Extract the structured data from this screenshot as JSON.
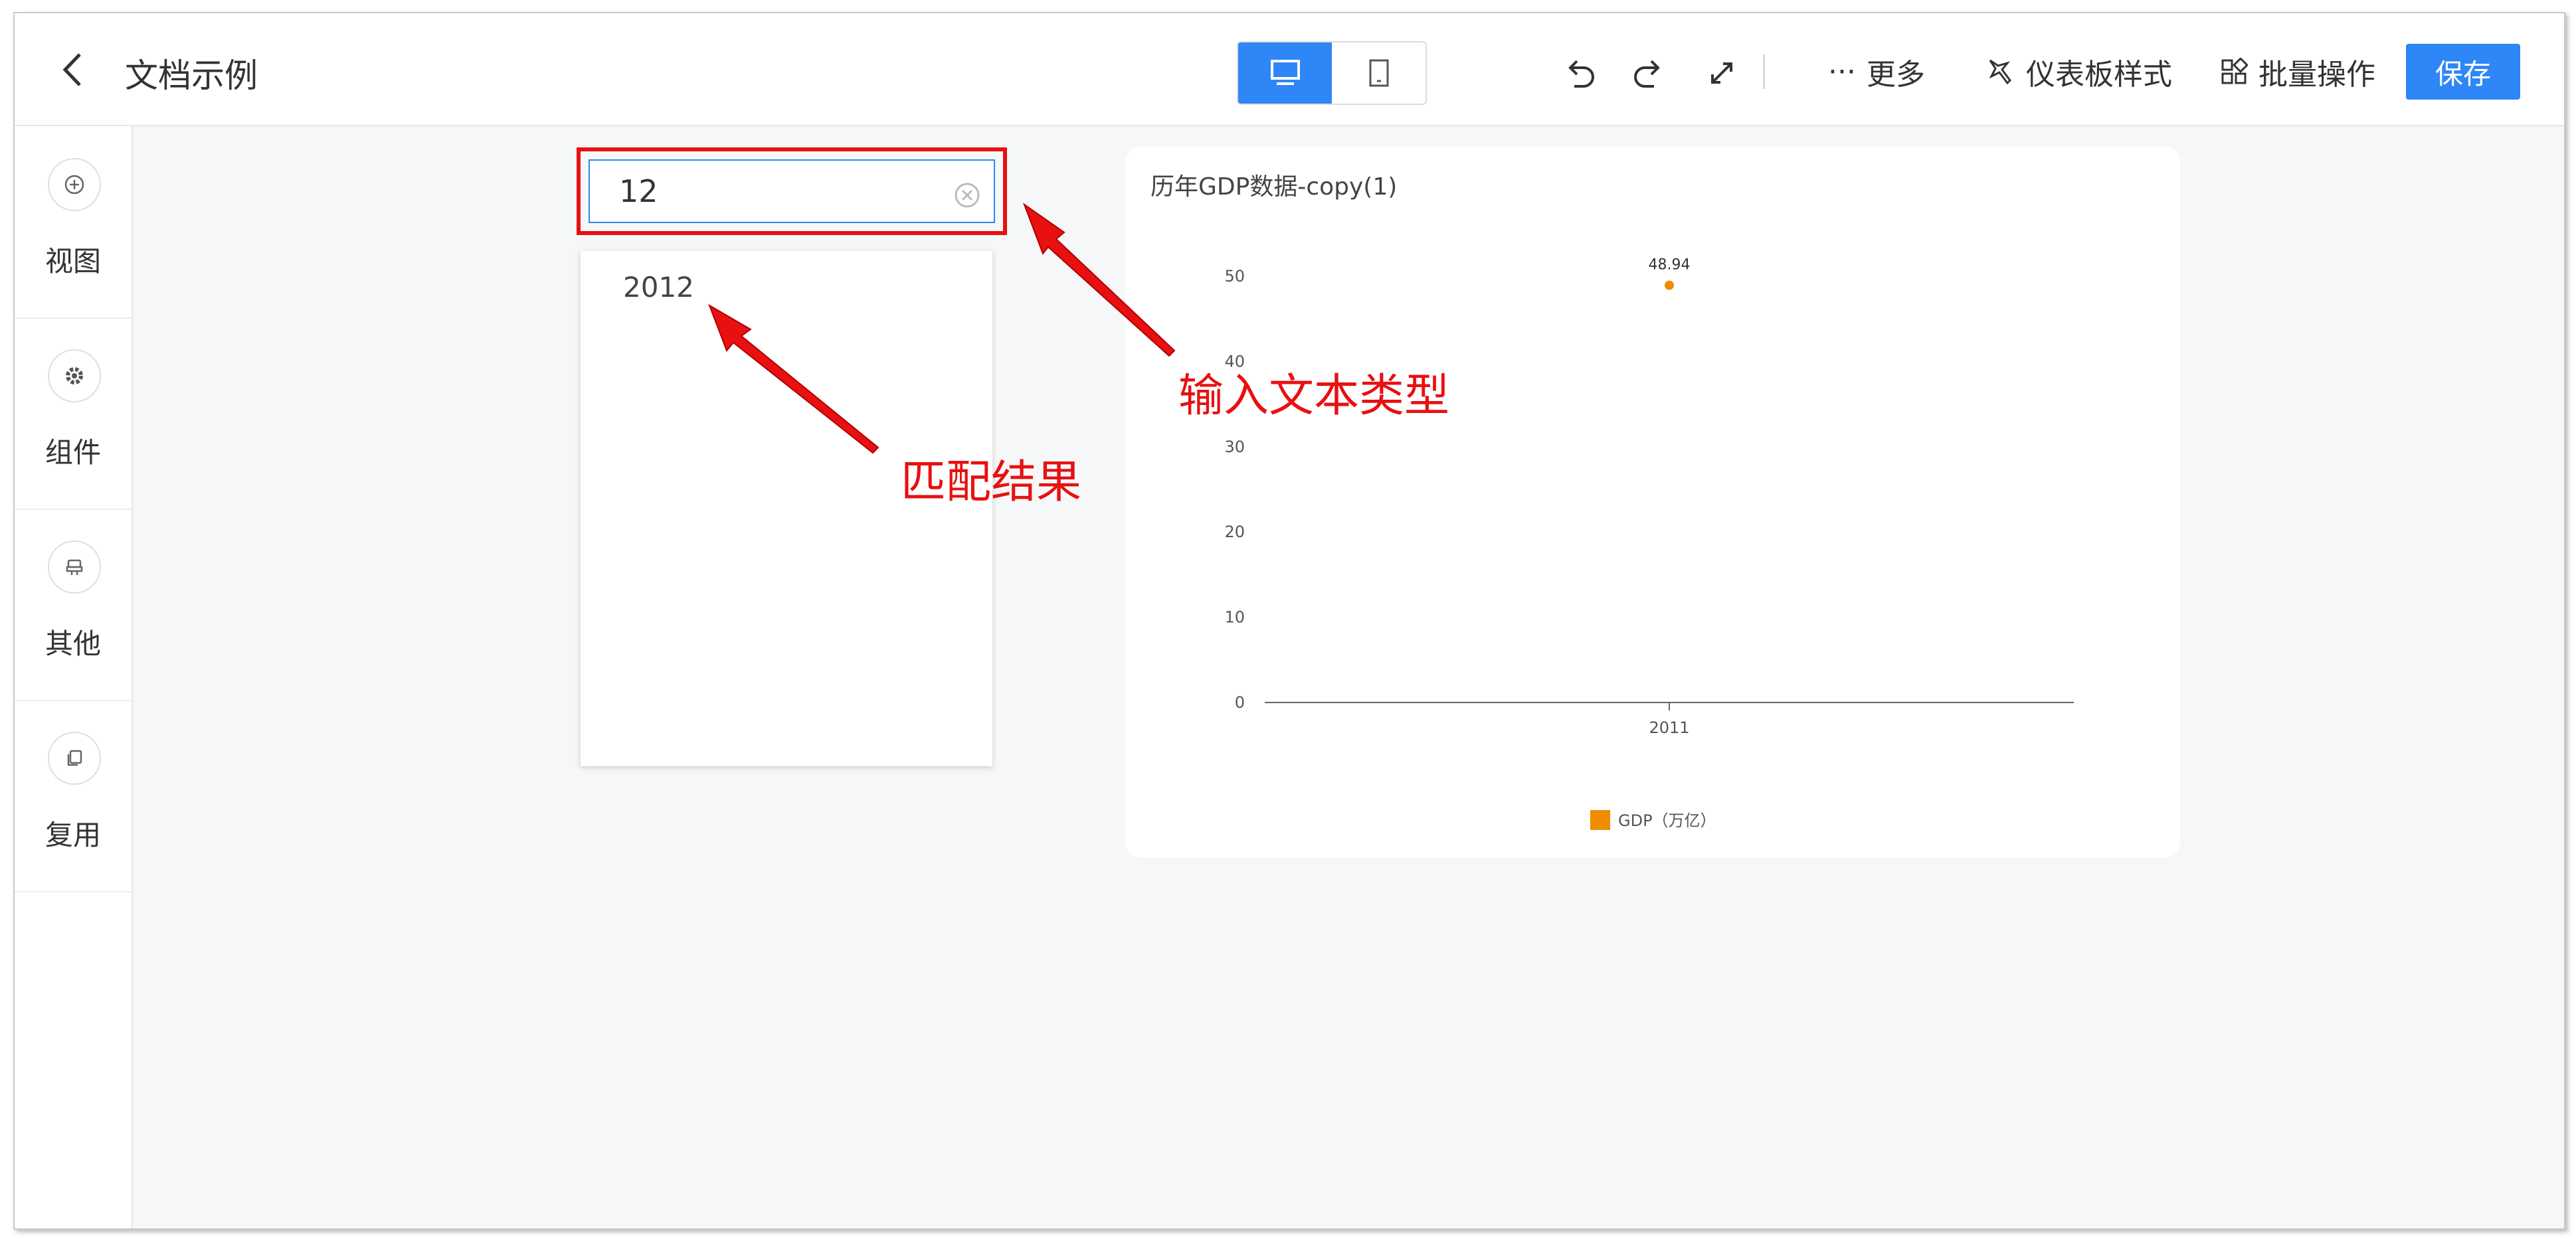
{
  "header": {
    "doc_title": "文档示例",
    "more_label": "更多",
    "dashboard_style_label": "仪表板样式",
    "batch_label": "批量操作",
    "save_label": "保存"
  },
  "sidebar": {
    "items": [
      {
        "label": "视图",
        "icon": "plus-circle-icon"
      },
      {
        "label": "组件",
        "icon": "gear-icon"
      },
      {
        "label": "其他",
        "icon": "stamp-icon"
      },
      {
        "label": "复用",
        "icon": "copy-icon"
      }
    ]
  },
  "search": {
    "value": "12",
    "results": [
      "2012"
    ]
  },
  "chart_data": {
    "type": "line",
    "title": "历年GDP数据-copy(1)",
    "categories": [
      "2011"
    ],
    "series": [
      {
        "name": "GDP（万亿）",
        "values": [
          48.94
        ],
        "color": "#f08c00"
      }
    ],
    "ylim": [
      0,
      50
    ],
    "yticks": [
      0,
      10,
      20,
      30,
      40,
      50
    ],
    "data_labels": [
      "48.94"
    ],
    "legend": "bottom-center"
  },
  "annotations": {
    "input_note": "输入文本类型",
    "match_note": "匹配结果"
  },
  "colors": {
    "accent": "#2f86f6",
    "annotation": "#e81010",
    "series": "#f08c00"
  }
}
